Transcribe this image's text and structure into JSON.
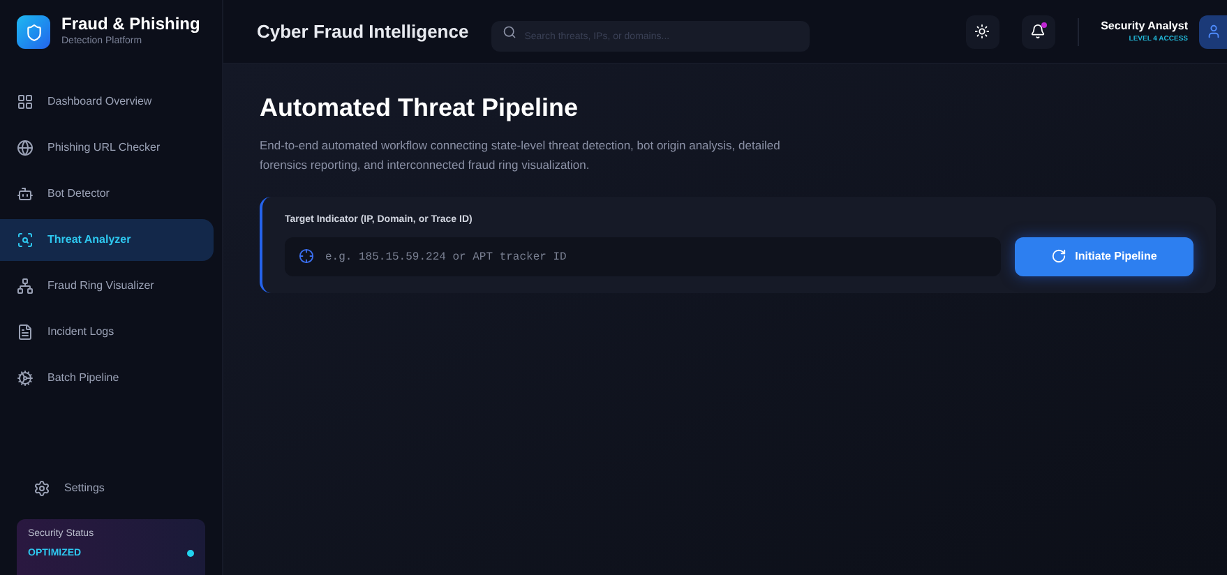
{
  "brand": {
    "title": "Fraud & Phishing",
    "subtitle": "Detection Platform"
  },
  "sidebar": {
    "items": [
      {
        "kind": "grid",
        "label": "Dashboard Overview",
        "selected": false
      },
      {
        "kind": "globe",
        "label": "Phishing URL Checker",
        "selected": false
      },
      {
        "kind": "bot",
        "label": "Bot Detector",
        "selected": false
      },
      {
        "kind": "scan",
        "label": "Threat Analyzer",
        "selected": true
      },
      {
        "kind": "network",
        "label": "Fraud Ring Visualizer",
        "selected": false
      },
      {
        "kind": "logs",
        "label": "Incident Logs",
        "selected": false
      },
      {
        "kind": "cogs",
        "label": "Batch Pipeline",
        "selected": false
      }
    ],
    "settings": "Settings",
    "status": {
      "label": "Security Status",
      "value": "OPTIMIZED"
    }
  },
  "header": {
    "title": "Cyber Fraud Intelligence",
    "search": {
      "placeholder": "Search threats, IPs, or domains..."
    },
    "notifications": {
      "unread": true
    },
    "user": {
      "name": "Security Analyst",
      "role": "LEVEL 4 ACCESS"
    }
  },
  "main": {
    "title": "Automated Threat Pipeline",
    "description": "End-to-end automated workflow connecting state-level threat detection, bot origin analysis, detailed forensics reporting, and interconnected fraud ring visualization.",
    "form": {
      "label": "Target Indicator (IP, Domain, or Trace ID)",
      "placeholder": "e.g. 185.15.59.224 or APT tracker ID",
      "button": "Initiate Pipeline"
    }
  }
}
